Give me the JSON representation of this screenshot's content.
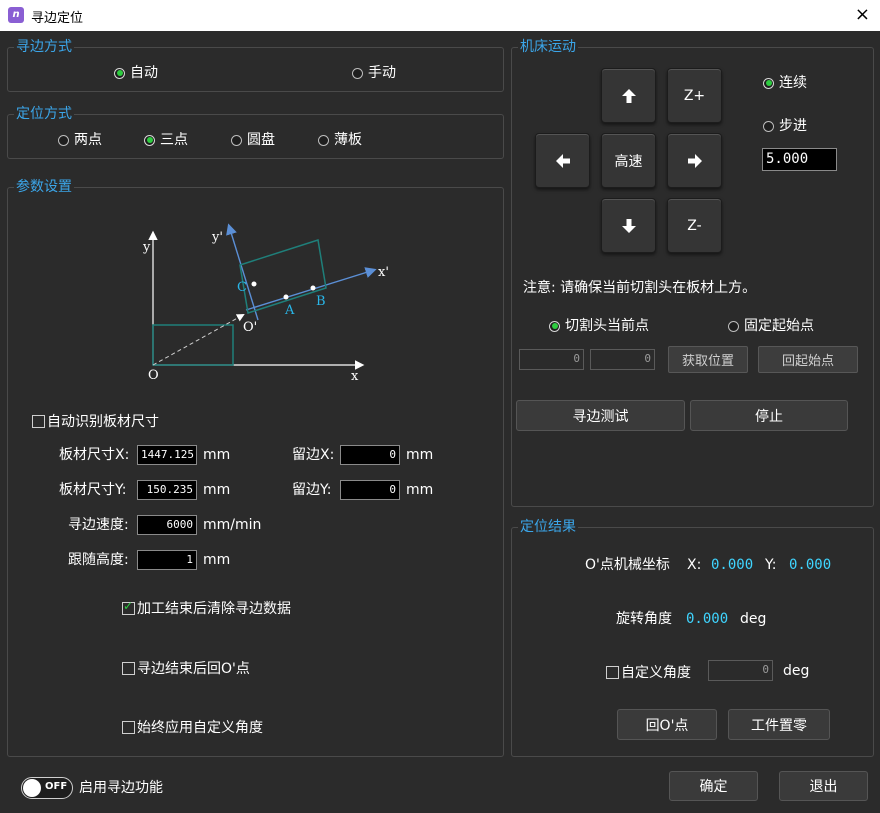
{
  "window": {
    "title": "寻边定位",
    "close_icon": "×"
  },
  "edge_mode": {
    "title": "寻边方式",
    "options": [
      "自动",
      "手动"
    ],
    "selected": "自动"
  },
  "locate_mode": {
    "title": "定位方式",
    "options": [
      "两点",
      "三点",
      "圆盘",
      "薄板"
    ],
    "selected": "三点"
  },
  "params": {
    "title": "参数设置",
    "diagram": {
      "y": "y",
      "x": "x",
      "o": "O",
      "y2": "y'",
      "x2": "x'",
      "o2": "O'",
      "a": "A",
      "b": "B",
      "c": "C"
    },
    "auto_size": {
      "label": "自动识别板材尺寸",
      "checked": false
    },
    "size_x": {
      "label": "板材尺寸X:",
      "value": "1447.125",
      "unit": "mm"
    },
    "size_y": {
      "label": "板材尺寸Y:",
      "value": "150.235",
      "unit": "mm"
    },
    "margin_x": {
      "label": "留边X:",
      "value": "0",
      "unit": "mm"
    },
    "margin_y": {
      "label": "留边Y:",
      "value": "0",
      "unit": "mm"
    },
    "speed": {
      "label": "寻边速度:",
      "value": "6000",
      "unit": "mm/min"
    },
    "height": {
      "label": "跟随高度:",
      "value": "1",
      "unit": "mm"
    },
    "clear_after": {
      "label": "加工结束后清除寻边数据",
      "checked": true
    },
    "return_after": {
      "label": "寻边结束后回O'点",
      "checked": false
    },
    "always_angle": {
      "label": "始终应用自定义角度",
      "checked": false
    }
  },
  "machine": {
    "title": "机床运动",
    "up_icon": "up-arrow",
    "z_plus": "Z+",
    "left_icon": "left-arrow",
    "high_speed": "高速",
    "right_icon": "right-arrow",
    "down_icon": "down-arrow",
    "z_minus": "Z-",
    "mode_continuous": "连续",
    "mode_step": "步进",
    "mode_selected": "连续",
    "step_value": "5.000",
    "note": "注意: 请确保当前切割头在板材上方。",
    "start_current": "切割头当前点",
    "start_fixed": "固定起始点",
    "start_selected": "切割头当前点",
    "pos_x": "0",
    "pos_y": "0",
    "get_pos": "获取位置",
    "back_start": "回起始点",
    "test": "寻边测试",
    "stop": "停止"
  },
  "result": {
    "title": "定位结果",
    "coord_label": "O'点机械坐标",
    "x_label": "X:",
    "x_value": "0.000",
    "y_label": "Y:",
    "y_value": "0.000",
    "angle_label": "旋转角度",
    "angle_value": "0.000",
    "angle_unit": "deg",
    "custom_angle": {
      "label": "自定义角度",
      "checked": false,
      "value": "0",
      "unit": "deg"
    },
    "back_o": "回O'点",
    "zero": "工件置零"
  },
  "footer": {
    "toggle_state": "OFF",
    "toggle_label": "启用寻边功能",
    "ok": "确定",
    "exit": "退出"
  },
  "colors": {
    "accent": "#3ba5e8",
    "radio_on": "#2ecc40",
    "value_cyan": "#3fd5ff",
    "diagram_teal": "#1f7f7a"
  }
}
